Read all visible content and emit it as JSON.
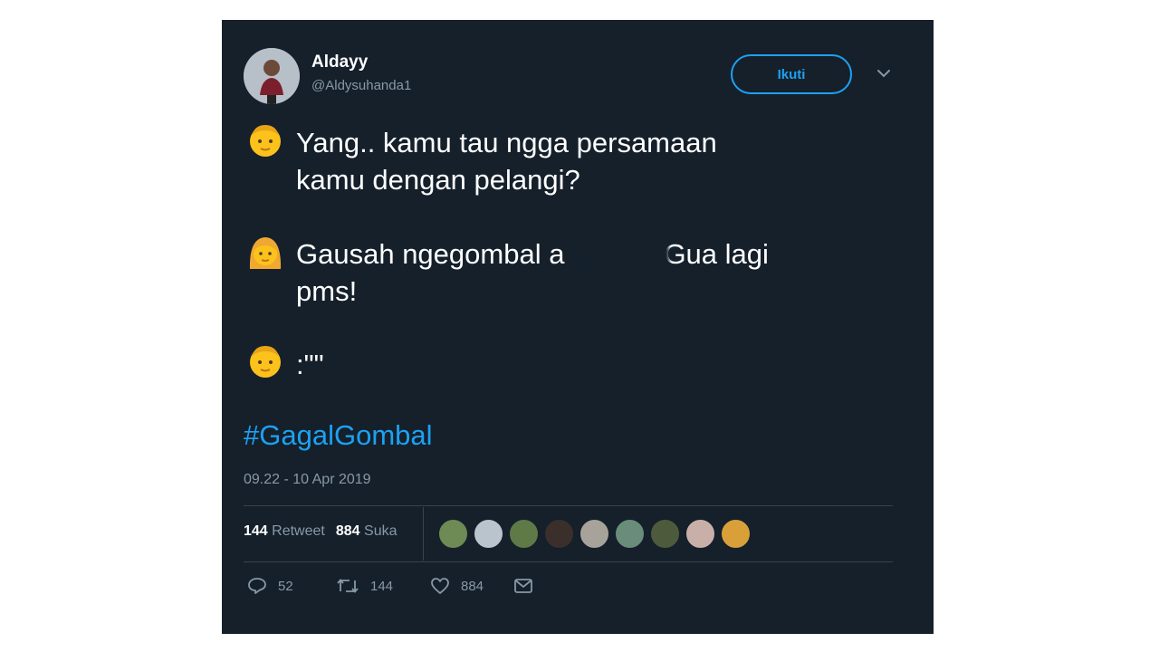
{
  "tweet": {
    "display_name": "Aldayy",
    "handle": "@Aldysuhanda1",
    "follow_label": "Ikuti",
    "lines": [
      {
        "emoji": "man-face",
        "text_1": "Yang.. kamu tau ngga persamaan",
        "text_2": "kamu dengan pelangi?"
      },
      {
        "emoji": "woman-face",
        "text_1": "Gausah ngegombal a",
        "text_1b": "Gua lagi",
        "text_2": "pms!"
      },
      {
        "emoji": "man-face",
        "text_1": ":\"\""
      }
    ],
    "hashtag": "#GagalGombal",
    "timestamp": "09.22 - 10 Apr 2019",
    "stats": {
      "retweets_count": "144",
      "retweets_label": "Retweet",
      "likes_count": "884",
      "likes_label": "Suka"
    },
    "actions": {
      "reply_count": "52",
      "retweet_count": "144",
      "like_count": "884"
    },
    "colors": {
      "background": "#15202b",
      "accent": "#1da1f2",
      "muted": "#8899a6"
    }
  }
}
